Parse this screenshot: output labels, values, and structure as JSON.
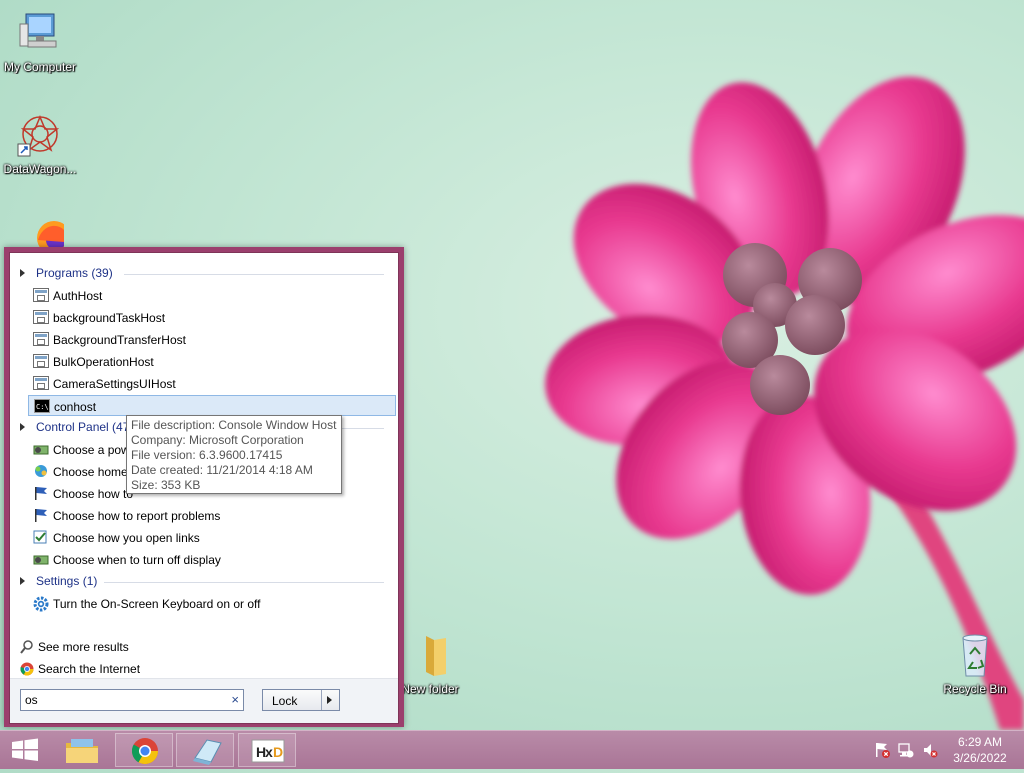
{
  "desktop": {
    "icons": [
      {
        "label": "My Computer"
      },
      {
        "label": "DataWagon..."
      },
      {
        "label": "New folder"
      },
      {
        "label": "Recycle Bin"
      }
    ]
  },
  "start_menu": {
    "groups": {
      "programs": {
        "header": "Programs (39)",
        "items": [
          "AuthHost",
          "backgroundTaskHost",
          "BackgroundTransferHost",
          "BulkOperationHost",
          "CameraSettingsUIHost",
          "conhost"
        ]
      },
      "control_panel": {
        "header": "Control Panel (47)",
        "items": [
          "Choose a pow",
          "Choose homeg",
          "Choose how to",
          "Choose how to report problems",
          "Choose how you open links",
          "Choose when to turn off display"
        ]
      },
      "settings": {
        "header": "Settings (1)",
        "items": [
          "Turn the On-Screen Keyboard on or off"
        ]
      }
    },
    "see_more": "See more results",
    "search_internet": "Search the Internet",
    "search": {
      "value": "os",
      "clear": "×"
    },
    "power_button": "Lock"
  },
  "tooltip": {
    "lines": [
      "File description: Console Window Host",
      "Company: Microsoft Corporation",
      "File version: 6.3.9600.17415",
      "Date created: 11/21/2014 4:18 AM",
      "Size: 353 KB"
    ]
  },
  "taskbar": {
    "clock_time": "6:29 AM",
    "clock_date": "3/26/2022",
    "cmd_glyph": "C:\\"
  },
  "colors": {
    "menu_border": "#9b3f6d",
    "selection": "#dbe9f8",
    "taskbar": "#b98ba8",
    "link_blue": "#1e3287"
  }
}
